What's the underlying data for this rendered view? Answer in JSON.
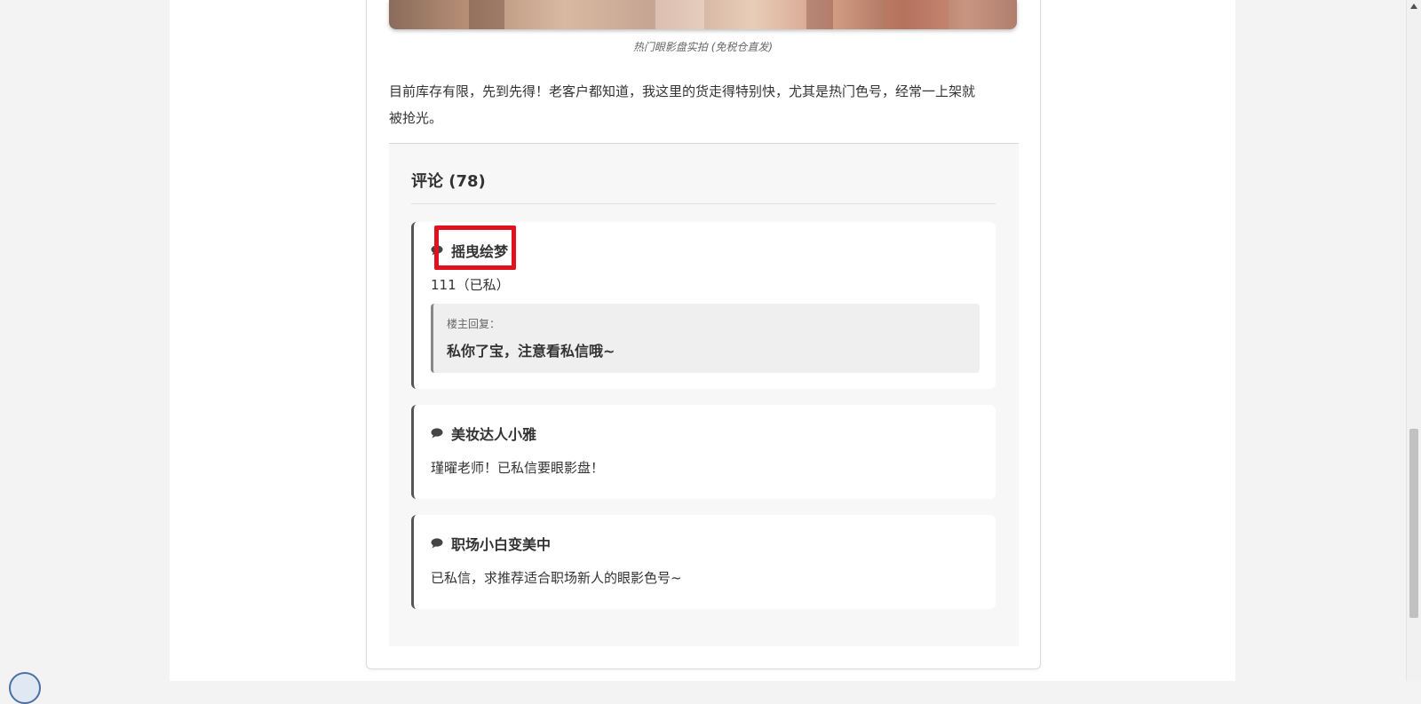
{
  "article": {
    "image_caption": "热门眼影盘实拍 (免税仓直发)",
    "body_line_1": "目前库存有限，先到先得！老客户都知道，我这里的货走得特别快，尤其是热门色号，经常一上架就",
    "body_line_2": "被抢光。"
  },
  "comments": {
    "title": "评论 (78)",
    "items": [
      {
        "author": "摇曳绘梦",
        "text": "111（已私）",
        "reply_label": "楼主回复：",
        "reply_text": "私你了宝，注意看私信哦~"
      },
      {
        "author": "美妆达人小雅",
        "text": "瑾曜老师！已私信要眼影盘！"
      },
      {
        "author": "职场小白变美中",
        "text": "已私信，求推荐适合职场新人的眼影色号~"
      }
    ]
  },
  "icons": {
    "comment": "speech-bubble-icon"
  },
  "colors": {
    "highlight": "#e0121f",
    "comment_accent": "#555555"
  }
}
